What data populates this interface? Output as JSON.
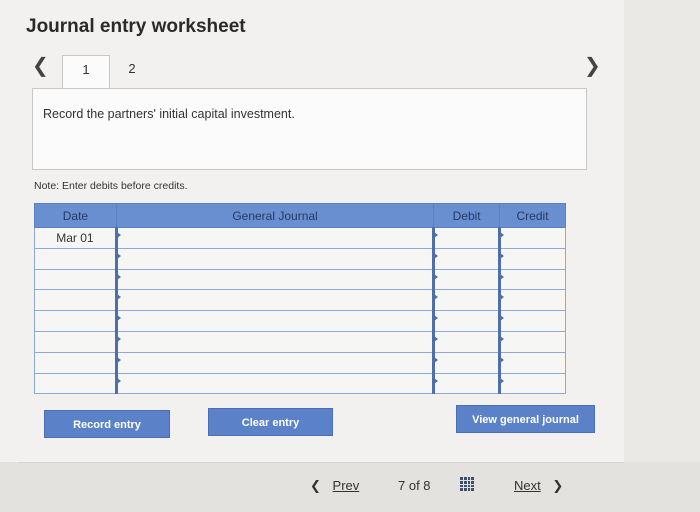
{
  "worksheet": {
    "title": "Journal entry worksheet"
  },
  "tabs": [
    {
      "label": "1"
    },
    {
      "label": "2"
    }
  ],
  "instruction": "Record the partners' initial capital investment.",
  "note": "Note: Enter debits before credits.",
  "table": {
    "headers": {
      "date": "Date",
      "account": "General Journal",
      "debit": "Debit",
      "credit": "Credit"
    },
    "rows": [
      {
        "date": "Mar 01",
        "account": "",
        "debit": "",
        "credit": ""
      },
      {
        "date": "",
        "account": "",
        "debit": "",
        "credit": ""
      },
      {
        "date": "",
        "account": "",
        "debit": "",
        "credit": ""
      },
      {
        "date": "",
        "account": "",
        "debit": "",
        "credit": ""
      },
      {
        "date": "",
        "account": "",
        "debit": "",
        "credit": ""
      },
      {
        "date": "",
        "account": "",
        "debit": "",
        "credit": ""
      },
      {
        "date": "",
        "account": "",
        "debit": "",
        "credit": ""
      },
      {
        "date": "",
        "account": "",
        "debit": "",
        "credit": ""
      }
    ]
  },
  "buttons": {
    "record": "Record entry",
    "clear": "Clear entry",
    "view": "View general journal"
  },
  "pager": {
    "prev": "Prev",
    "position": "7 of 8",
    "next": "Next"
  },
  "icons": {
    "left": "chevron-left-icon",
    "right": "chevron-right-icon",
    "grid": "grid-icon"
  },
  "colors": {
    "header_blue": "#6a8fd0",
    "button_blue": "#5b82c9"
  }
}
